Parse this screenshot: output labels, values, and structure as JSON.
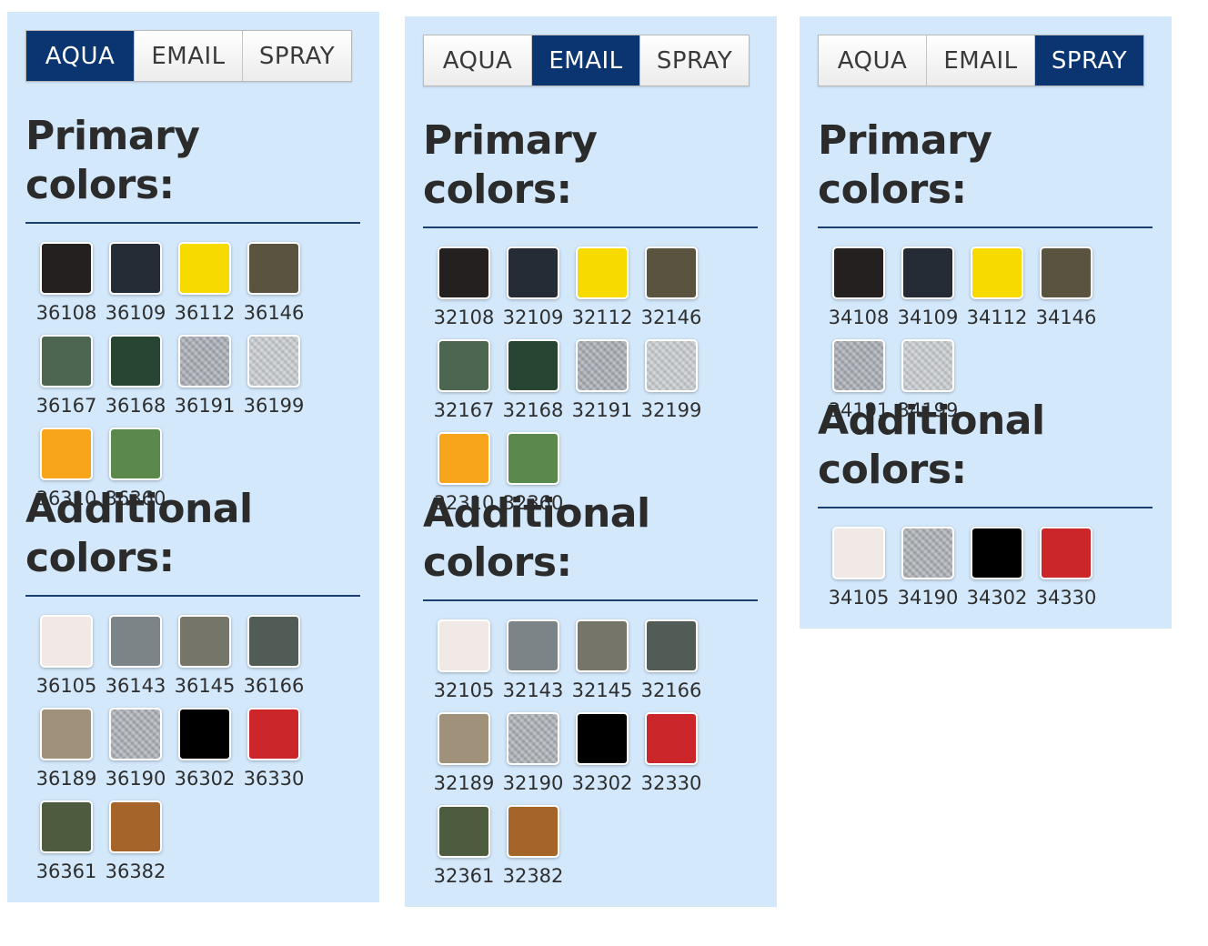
{
  "tab_labels": [
    "AQUA",
    "EMAIL",
    "SPRAY"
  ],
  "panels": [
    {
      "id": "aqua",
      "active_tab": 0,
      "primary_title": "Primary colors:",
      "additional_title_line1": "Additional",
      "additional_title_line2": "colors:",
      "primary": [
        {
          "code": "36108",
          "color": "#252020"
        },
        {
          "code": "36109",
          "color": "#262c35"
        },
        {
          "code": "36112",
          "color": "#f6da00"
        },
        {
          "code": "36146",
          "color": "#5a5340"
        },
        {
          "code": "36167",
          "color": "#4d6652"
        },
        {
          "code": "36168",
          "color": "#264533"
        },
        {
          "code": "36191",
          "color": "#a6aab2",
          "metallic": true
        },
        {
          "code": "36199",
          "color": "#c6cacd",
          "metallic": true
        },
        {
          "code": "36310",
          "color": "#f8a51c"
        },
        {
          "code": "36360",
          "color": "#5a894b"
        }
      ],
      "additional": [
        {
          "code": "36105",
          "color": "#f1e9e6"
        },
        {
          "code": "36143",
          "color": "#7d8488"
        },
        {
          "code": "36145",
          "color": "#767569"
        },
        {
          "code": "36166",
          "color": "#525c56"
        },
        {
          "code": "36189",
          "color": "#9f917a"
        },
        {
          "code": "36190",
          "color": "#a9adb3",
          "metallic": true
        },
        {
          "code": "36302",
          "color": "#000000"
        },
        {
          "code": "36330",
          "color": "#cb262a"
        },
        {
          "code": "36361",
          "color": "#4d5c3f"
        },
        {
          "code": "36382",
          "color": "#a5652a"
        }
      ]
    },
    {
      "id": "email",
      "active_tab": 1,
      "primary_title": "Primary colors:",
      "additional_title_line1": "Additional",
      "additional_title_line2": "colors:",
      "primary": [
        {
          "code": "32108",
          "color": "#252020"
        },
        {
          "code": "32109",
          "color": "#262c35"
        },
        {
          "code": "32112",
          "color": "#f6da00"
        },
        {
          "code": "32146",
          "color": "#5a5340"
        },
        {
          "code": "32167",
          "color": "#4d6652"
        },
        {
          "code": "32168",
          "color": "#264533"
        },
        {
          "code": "32191",
          "color": "#a6aab2",
          "metallic": true
        },
        {
          "code": "32199",
          "color": "#c6cacd",
          "metallic": true
        },
        {
          "code": "32310",
          "color": "#f8a51c"
        },
        {
          "code": "32360",
          "color": "#5a894b"
        }
      ],
      "additional": [
        {
          "code": "32105",
          "color": "#f1e9e6"
        },
        {
          "code": "32143",
          "color": "#7d8488"
        },
        {
          "code": "32145",
          "color": "#767569"
        },
        {
          "code": "32166",
          "color": "#525c56"
        },
        {
          "code": "32189",
          "color": "#9f917a"
        },
        {
          "code": "32190",
          "color": "#a9adb3",
          "metallic": true
        },
        {
          "code": "32302",
          "color": "#000000"
        },
        {
          "code": "32330",
          "color": "#cb262a"
        },
        {
          "code": "32361",
          "color": "#4d5c3f"
        },
        {
          "code": "32382",
          "color": "#a5652a"
        }
      ]
    },
    {
      "id": "spray",
      "active_tab": 2,
      "primary_title": "Primary colors:",
      "additional_title_line1": "Additional",
      "additional_title_line2": "colors:",
      "primary": [
        {
          "code": "34108",
          "color": "#252020"
        },
        {
          "code": "34109",
          "color": "#262c35"
        },
        {
          "code": "34112",
          "color": "#f6da00"
        },
        {
          "code": "34146",
          "color": "#5a5340"
        },
        {
          "code": "34191",
          "color": "#a6aab2",
          "metallic": true
        },
        {
          "code": "34199",
          "color": "#c6cacd",
          "metallic": true
        }
      ],
      "additional": [
        {
          "code": "34105",
          "color": "#f1e9e6"
        },
        {
          "code": "34190",
          "color": "#a9adb3",
          "metallic": true
        },
        {
          "code": "34302",
          "color": "#000000"
        },
        {
          "code": "34330",
          "color": "#cb262a"
        }
      ]
    }
  ]
}
